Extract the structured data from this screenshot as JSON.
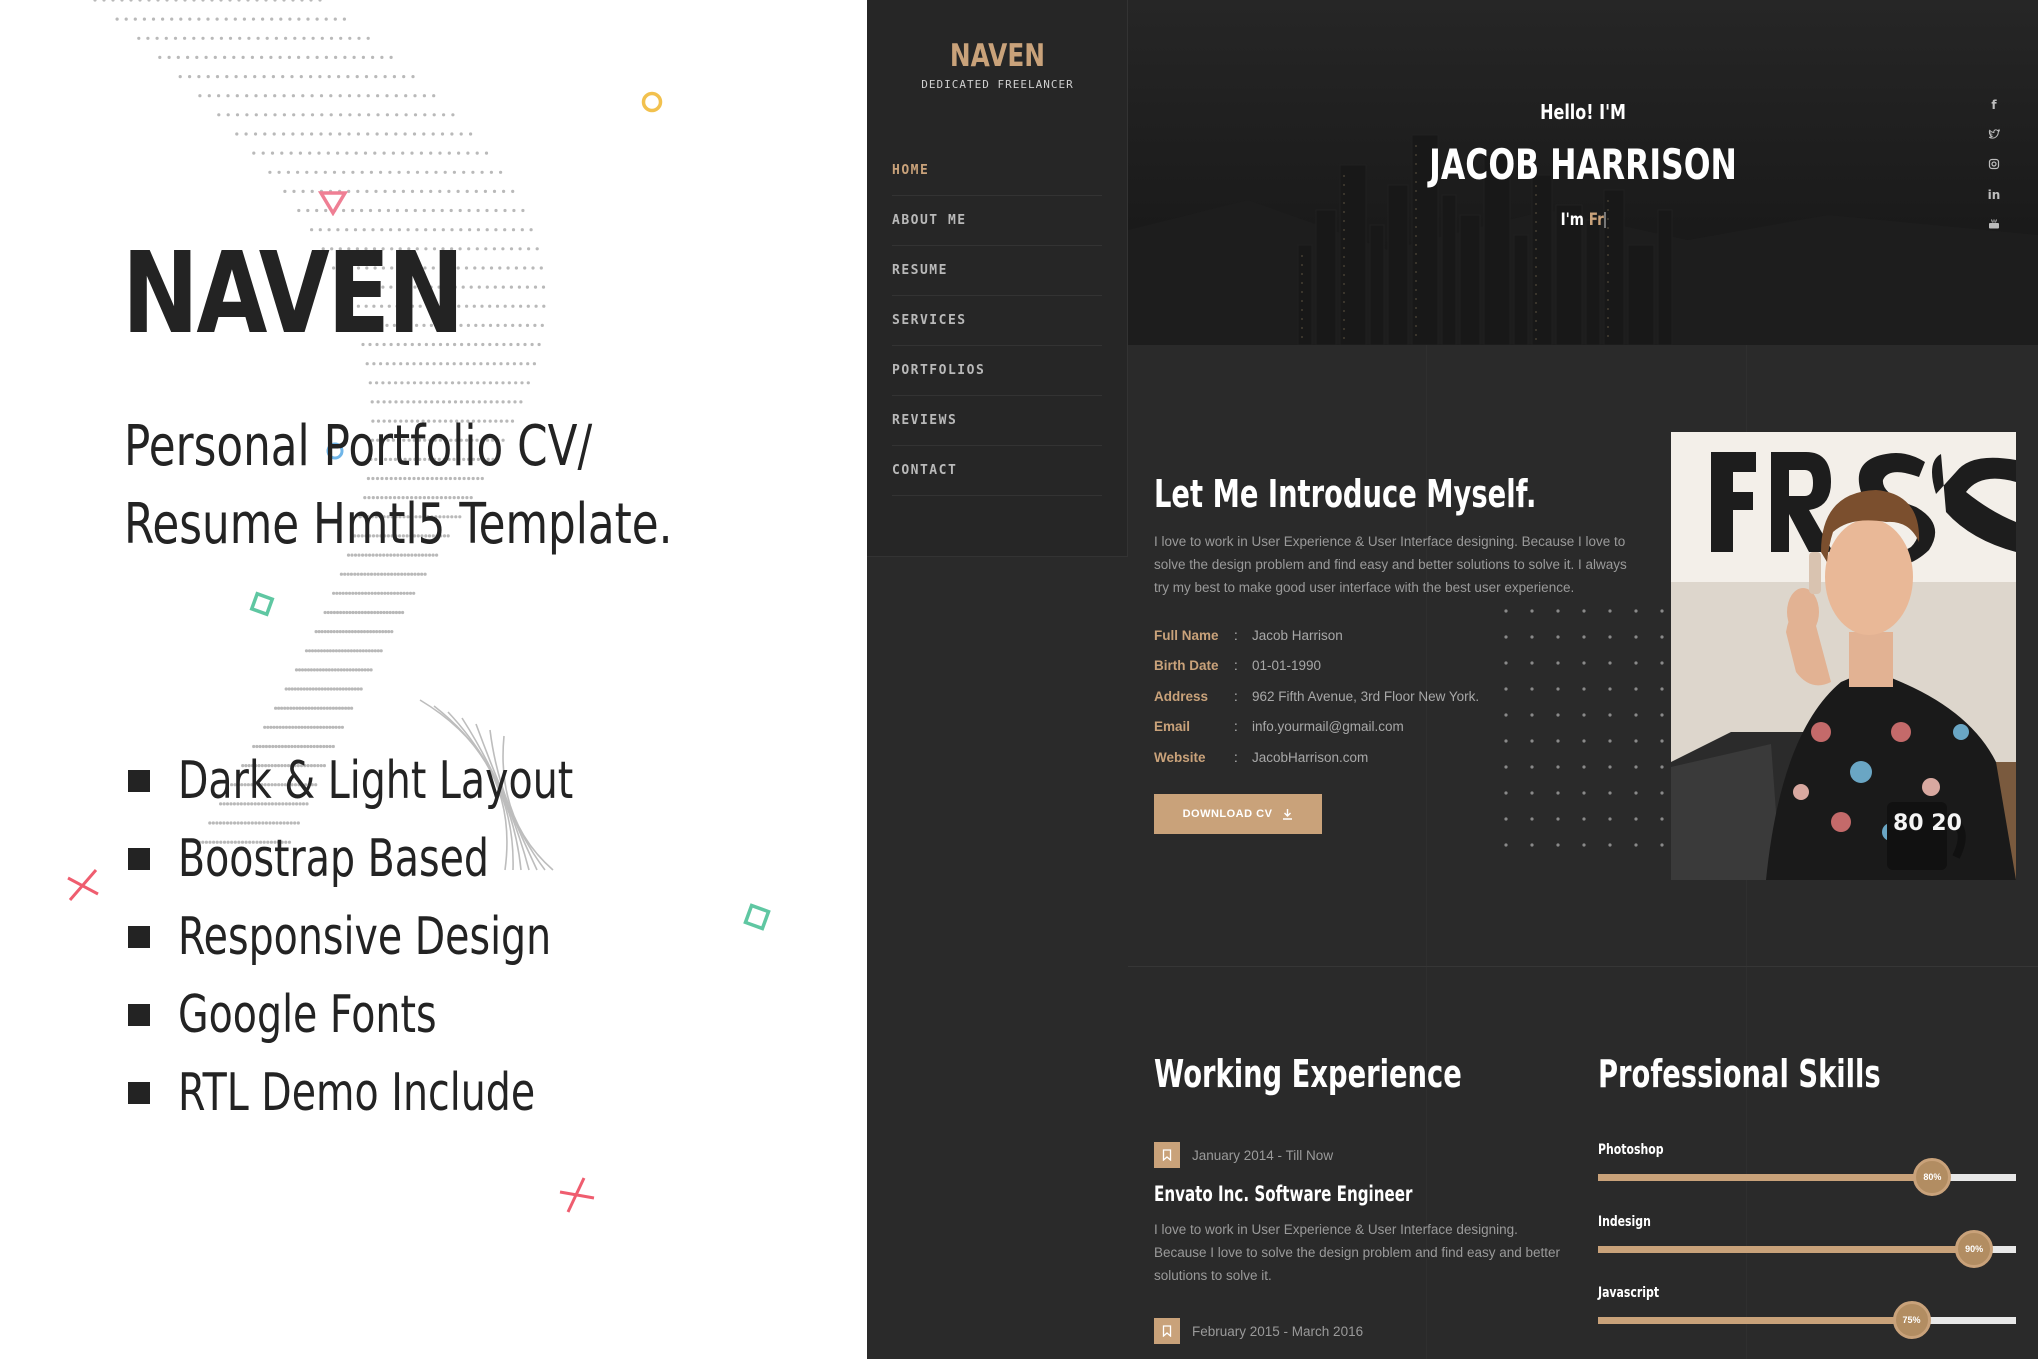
{
  "promo": {
    "title": "NAVEN",
    "subtitle": "Personal Portfolio CV/ Resume Hmtl5 Template.",
    "features": [
      "Dark & Light Layout",
      "Boostrap Based",
      "Responsive Design",
      "Google Fonts",
      "RTL Demo Include"
    ]
  },
  "sidebar": {
    "brand": "NAVEN",
    "tagline": "DEDICATED FREELANCER",
    "nav": [
      "HOME",
      "ABOUT ME",
      "RESUME",
      "SERVICES",
      "PORTFOLIOS",
      "REVIEWS",
      "CONTACT"
    ],
    "active": "HOME"
  },
  "hero": {
    "greeting": "Hello! I'M",
    "name": "JACOB HARRISON",
    "typed_prefix": "I'm ",
    "typed_word": "Fr",
    "social": [
      "f",
      "twitter-icon",
      "instagram-icon",
      "in",
      "youtube-icon"
    ]
  },
  "about": {
    "heading": "Let Me Introduce Myself.",
    "intro": "I love to work in User Experience & User Interface designing. Because I love to solve the design problem and find easy and better solutions to solve it. I always try my best to make good user interface with the best user experience.",
    "info": [
      {
        "key": "Full Name",
        "value": "Jacob Harrison"
      },
      {
        "key": "Birth Date",
        "value": "01-01-1990"
      },
      {
        "key": "Address",
        "value": "962 Fifth Avenue, 3rd Floor New York."
      },
      {
        "key": "Email",
        "value": "info.yourmail@gmail.com"
      },
      {
        "key": "Website",
        "value": "JacobHarrison.com"
      }
    ],
    "download_label": "DOWNLOAD CV",
    "mug_text": "80 20"
  },
  "experience": {
    "heading": "Working Experience",
    "items": [
      {
        "date": "January 2014 - Till Now",
        "title": "Envato Inc. Software Engineer",
        "desc": "I love to work in User Experience & User Interface designing. Because I love to solve the design problem and find easy and better solutions to solve it."
      },
      {
        "date": "February 2015 - March 2016",
        "title": "",
        "desc": ""
      }
    ]
  },
  "skills": {
    "heading": "Professional Skills",
    "items": [
      {
        "name": "Photoshop",
        "percent": 80,
        "label": "80%"
      },
      {
        "name": "Indesign",
        "percent": 90,
        "label": "90%"
      },
      {
        "name": "Javascript",
        "percent": 75,
        "label": "75%"
      }
    ]
  },
  "colors": {
    "accent": "#c9a27a",
    "dark_bg": "#2a2a2a",
    "sidebar_bg": "#262626",
    "promo_bg": "#ffffff",
    "promo_text": "#232323"
  }
}
